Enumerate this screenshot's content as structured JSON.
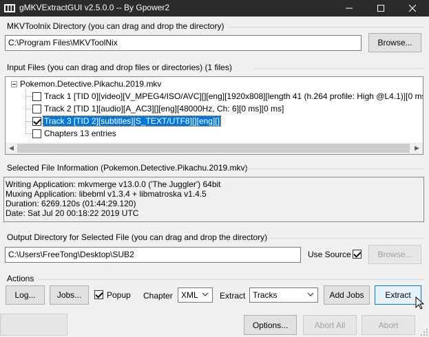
{
  "window": {
    "title": "gMKVExtractGUI v2.5.0.0 -- By Gpower2",
    "minimize_icon": "minimize-icon",
    "maximize_icon": "maximize-icon",
    "close_icon": "close-icon"
  },
  "mkvtoolnix": {
    "label": "MKVToolnix Directory (you can drag and drop the directory)",
    "path": "C:\\Program Files\\MKVToolNix",
    "browse_label": "Browse..."
  },
  "input": {
    "label": "Input Files (you can drag and drop files or directories) (1 files)",
    "file": "Pokemon.Detective.Pikachu.2019.mkv",
    "tracks": [
      {
        "text": "Track 1 [TID 0][video][V_MPEG4/ISO/AVC][][eng][1920x808][length 41 (h.264 profile: High @L4.1)][0 ms][0",
        "checked": false,
        "selected": false
      },
      {
        "text": "Track 2 [TID 1][audio][A_AC3][][eng][48000Hz, Ch: 6][0 ms][0 ms]",
        "checked": false,
        "selected": false
      },
      {
        "text": "Track 3 [TID 2][subtitles][S_TEXT/UTF8][][eng][]",
        "checked": true,
        "selected": true
      },
      {
        "text": "Chapters 13 entries",
        "checked": false,
        "selected": false
      }
    ]
  },
  "selected_info": {
    "label": "Selected File Information (Pokemon.Detective.Pikachu.2019.mkv)",
    "lines": [
      "Writing Application: mkvmerge v13.0.0 ('The Juggler') 64bit",
      "Muxing Application: libebml v1.3.4 + libmatroska v1.4.5",
      "Duration: 6269.120s (01:44:29.120)",
      "Date: Sat Jul 20 00:18:22 2019 UTC"
    ]
  },
  "output": {
    "label": "Output Directory for Selected File (you can drag and drop the directory)",
    "path": "C:\\Users\\FreeTong\\Desktop\\SUB2",
    "use_source_label": "Use Source",
    "use_source_checked": true,
    "browse_label": "Browse..."
  },
  "actions": {
    "label": "Actions",
    "log_label": "Log...",
    "jobs_label": "Jobs...",
    "popup_label": "Popup",
    "popup_checked": true,
    "chapter_label": "Chapter",
    "chapter_value": "XML",
    "extract_label": "Extract",
    "extract_value": "Tracks",
    "add_jobs_label": "Add Jobs",
    "extract_button_label": "Extract"
  },
  "footer": {
    "options_label": "Options...",
    "abort_all_label": "Abort All",
    "abort_label": "Abort"
  }
}
